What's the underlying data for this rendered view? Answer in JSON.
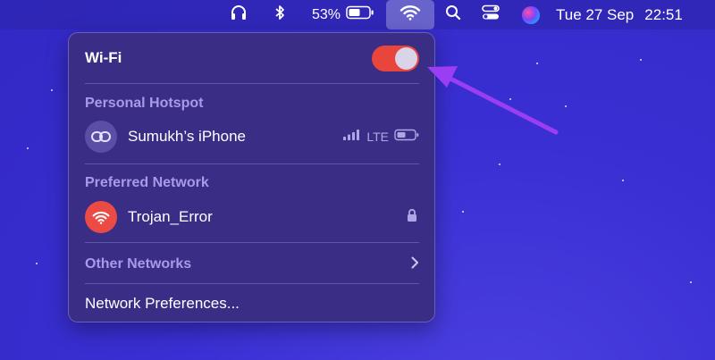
{
  "menubar": {
    "battery_percent": "53%",
    "date": "Tue 27 Sep",
    "time": "22:51",
    "icons": [
      "headphones-icon",
      "bluetooth-icon",
      "battery-icon",
      "wifi-icon",
      "search-icon",
      "control-center-icon",
      "siri-icon"
    ]
  },
  "wifi_menu": {
    "title": "Wi-Fi",
    "toggle_on": true,
    "personal_hotspot": {
      "heading": "Personal Hotspot",
      "device_name": "Sumukh’s iPhone",
      "signal": "LTE"
    },
    "preferred_network": {
      "heading": "Preferred Network",
      "network_name": "Trojan_Error",
      "secured": true
    },
    "other_networks_label": "Other Networks",
    "network_preferences_label": "Network Preferences..."
  },
  "colors": {
    "desktop": "#3a2fd3",
    "panel": "#3a2d86",
    "toggle_on": "#e8453c",
    "section_heading": "#a89ae8",
    "annotation_arrow": "#9b3df2"
  }
}
